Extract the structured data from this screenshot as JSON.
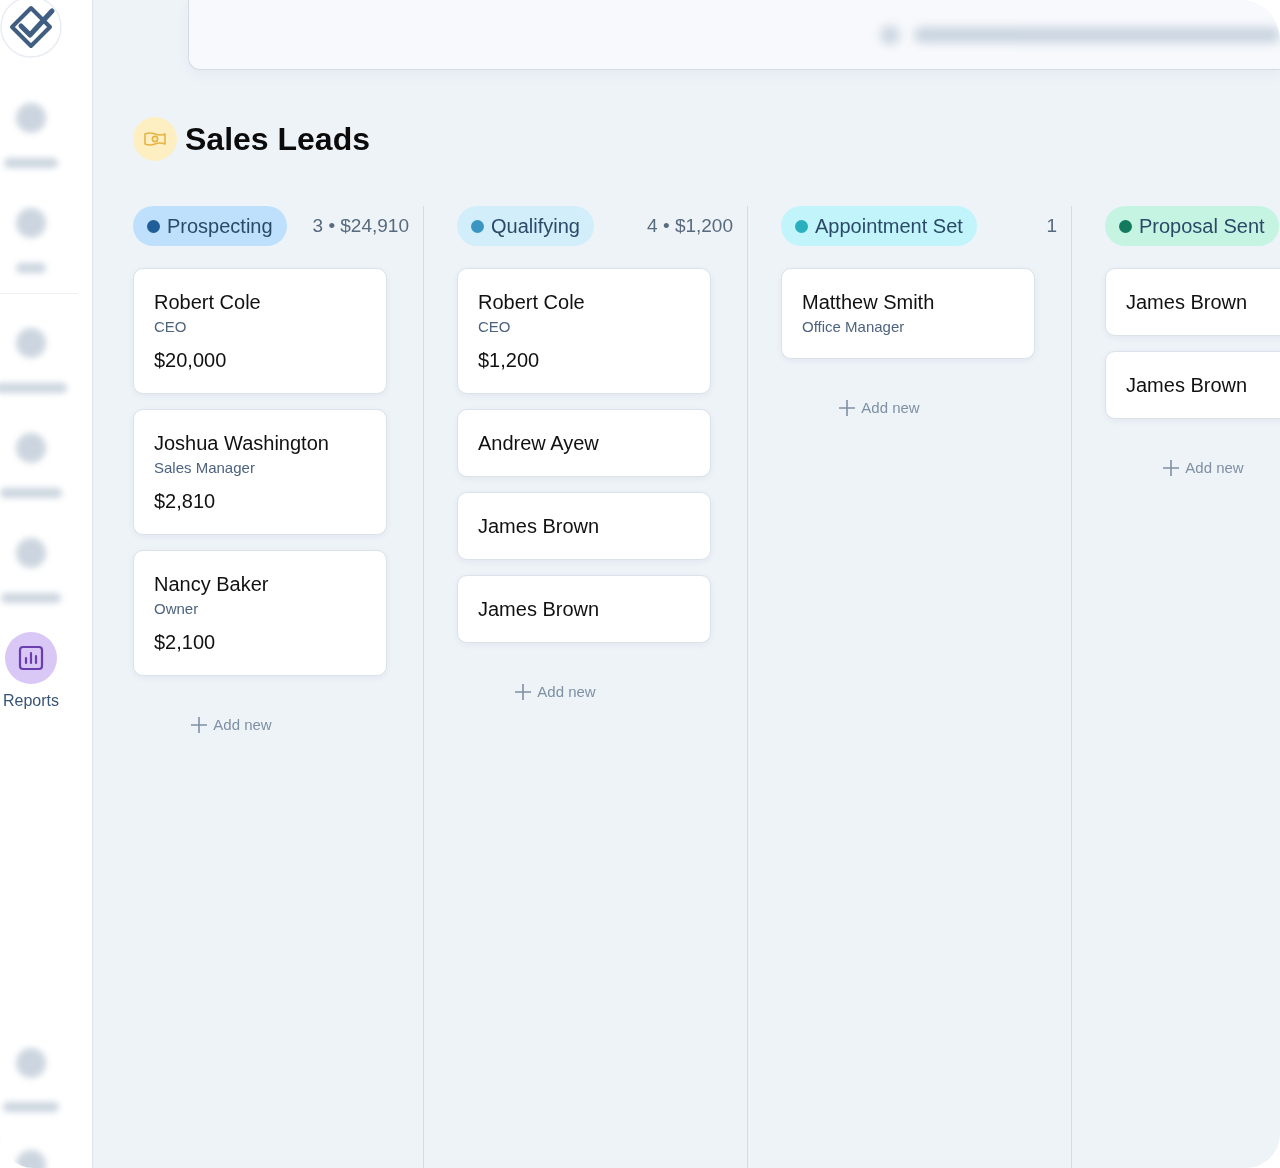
{
  "sidebar": {
    "items": [
      {
        "label": "Reports",
        "selected": true
      }
    ]
  },
  "page": {
    "title": "Sales Leads"
  },
  "columns": [
    {
      "label": "Prospecting",
      "color": "#1f5e98",
      "summary": "3 • $24,910",
      "cards": [
        {
          "name": "Robert Cole",
          "role": "CEO",
          "amount": "$20,000"
        },
        {
          "name": "Joshua Washington",
          "role": "Sales Manager",
          "amount": "$2,810"
        },
        {
          "name": "Nancy Baker",
          "role": "Owner",
          "amount": "$2,100"
        }
      ],
      "add_label": "Add new"
    },
    {
      "label": "Qualifying",
      "color": "#3b95c3",
      "summary": "4 • $1,200",
      "cards": [
        {
          "name": "Robert Cole",
          "role": "CEO",
          "amount": "$1,200"
        },
        {
          "name": "Andrew Ayew"
        },
        {
          "name": "James Brown"
        },
        {
          "name": "James Brown"
        }
      ],
      "add_label": "Add new"
    },
    {
      "label": "Appointment Set",
      "color": "#2aafbf",
      "summary": "1",
      "cards": [
        {
          "name": "Matthew Smith",
          "role": "Office Manager"
        }
      ],
      "add_label": "Add new"
    },
    {
      "label": "Proposal Sent",
      "color": "#127a5d",
      "cards": [
        {
          "name": "James Brown"
        },
        {
          "name": "James Brown"
        }
      ],
      "add_label": "Add new"
    }
  ]
}
